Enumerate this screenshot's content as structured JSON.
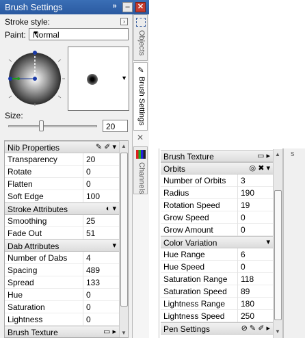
{
  "title": "Brush Settings",
  "stroke_style_label": "Stroke style:",
  "paint_label": "Paint:",
  "paint_value": "Normal",
  "size_label": "Size:",
  "size_value": "20",
  "tabs": [
    "Objects",
    "Brush Settings",
    "Channels"
  ],
  "left_grid": [
    {
      "group": "Nib Properties",
      "icons": "✎ ✐ ▾"
    },
    {
      "k": "Transparency",
      "v": "20"
    },
    {
      "k": "Rotate",
      "v": "0"
    },
    {
      "k": "Flatten",
      "v": "0"
    },
    {
      "k": "Soft Edge",
      "v": "100"
    },
    {
      "group": "Stroke Attributes",
      "icons": "◐ ▾"
    },
    {
      "k": "Smoothing",
      "v": "25"
    },
    {
      "k": "Fade Out",
      "v": "51"
    },
    {
      "group": "Dab Attributes",
      "icons": "▾"
    },
    {
      "k": "Number of Dabs",
      "v": "4"
    },
    {
      "k": "Spacing",
      "v": "489"
    },
    {
      "k": "Spread",
      "v": "133"
    },
    {
      "k": "Hue",
      "v": "0"
    },
    {
      "k": "Saturation",
      "v": "0"
    },
    {
      "k": "Lightness",
      "v": "0"
    },
    {
      "group": "Brush Texture",
      "icons": "▭ ▸"
    }
  ],
  "right_grid": [
    {
      "group": "Brush Texture",
      "icons": "▭ ▸"
    },
    {
      "group": "Orbits",
      "icons": "◎ ✖ ▾"
    },
    {
      "k": "Number of Orbits",
      "v": "3"
    },
    {
      "k": "Radius",
      "v": "190"
    },
    {
      "k": "Rotation Speed",
      "v": "19"
    },
    {
      "k": "Grow Speed",
      "v": "0"
    },
    {
      "k": "Grow Amount",
      "v": "0"
    },
    {
      "group": "Color Variation",
      "icons": "▾"
    },
    {
      "k": "Hue Range",
      "v": "6"
    },
    {
      "k": "Hue Speed",
      "v": "0"
    },
    {
      "k": "Saturation Range",
      "v": "118"
    },
    {
      "k": "Saturation Speed",
      "v": "89"
    },
    {
      "k": "Lightness Range",
      "v": "180"
    },
    {
      "k": "Lightness Speed",
      "v": "250"
    },
    {
      "group": "Pen Settings",
      "icons": "⊘ ✎ ✐ ▸"
    }
  ],
  "right_edge_text": "s"
}
